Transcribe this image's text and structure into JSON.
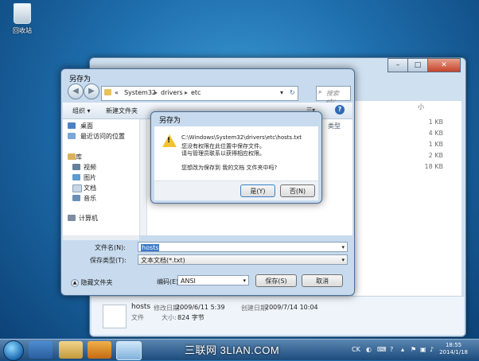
{
  "desktop": {
    "recycle_bin_label": "回收站"
  },
  "bg_window": {
    "column_header": "小",
    "sizes": [
      "1 KB",
      "4 KB",
      "1 KB",
      "2 KB",
      "18 KB"
    ],
    "details": {
      "file_name": "hosts",
      "modified_label": "修改日期:",
      "modified_value": "2009/6/11 5:39",
      "created_label": "创建日期:",
      "created_value": "2009/7/14 10:04",
      "file_type": "文件",
      "size_label": "大小:",
      "size_value": "824 字节"
    }
  },
  "save_dialog": {
    "title": "另存为",
    "breadcrumb": [
      "«",
      "System32",
      "drivers",
      "etc"
    ],
    "search_placeholder": "搜索 etc",
    "toolbar": {
      "organize": "组织 ▾",
      "new_folder": "新建文件夹",
      "type_col": "类型"
    },
    "nav_items": [
      "桌面",
      "最近访问的位置",
      "库",
      "视频",
      "图片",
      "文档",
      "音乐",
      "计算机"
    ],
    "filename_label": "文件名(N):",
    "filename_value": "hosts",
    "savetype_label": "保存类型(T):",
    "savetype_value": "文本文档(*.txt)",
    "hide_folders": "隐藏文件夹",
    "encoding_label": "编码(E):",
    "encoding_value": "ANSI",
    "save_button": "保存(S)",
    "cancel_button": "取消"
  },
  "alert": {
    "title": "另存为",
    "path": "C:\\Windows\\System32\\drivers\\etc\\hosts.txt",
    "line1": "您没有权限在此位置中保存文件。",
    "line2": "请与管理员联系以获得相应权限。",
    "question": "您想改为保存到 我的文档 文件夹中吗?",
    "yes_button": "是(Y)",
    "no_button": "否(N)"
  },
  "taskbar": {
    "watermark": "三联网 3LIAN.COM",
    "lang": "CK",
    "time": "18:55",
    "date": "2014/1/18"
  },
  "colors": {
    "accent": "#1f6fae",
    "warning": "#f1c232"
  }
}
